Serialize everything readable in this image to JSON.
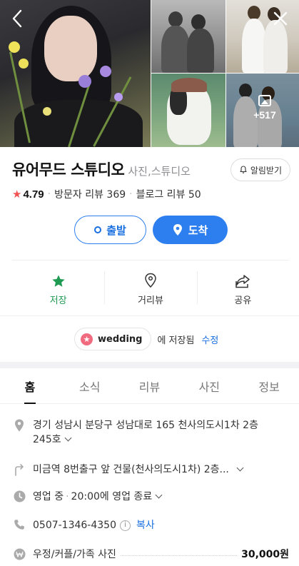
{
  "header": {
    "back_icon": "chevron-left-icon",
    "close_icon": "close-icon",
    "more_photos_count": "+517"
  },
  "place": {
    "name": "유어무드 스튜디오",
    "category": "사진,스튜디오",
    "alarm_label": "알림받기",
    "rating": "4.79",
    "visitor_reviews": "방문자 리뷰 369",
    "blog_reviews": "블로그 리뷰 50"
  },
  "route": {
    "departure_label": "출발",
    "arrival_label": "도착"
  },
  "actions": {
    "save_label": "저장",
    "streetview_label": "거리뷰",
    "share_label": "공유"
  },
  "saved": {
    "folder_name": "wedding",
    "saved_text": "에 저장됨",
    "edit_label": "수정"
  },
  "tabs": [
    {
      "label": "홈"
    },
    {
      "label": "소식"
    },
    {
      "label": "리뷰"
    },
    {
      "label": "사진"
    },
    {
      "label": "정보"
    }
  ],
  "info": {
    "address_line1": "경기 성남시 분당구 성남대로 165 천사의도시1차 2층",
    "address_line2": "245호",
    "directions": "미금역 8번출구 앞 건물(천사의도시1차) 2층...",
    "hours_status": "영업 중",
    "hours_detail": "20:00에 영업 종료",
    "phone": "0507-1346-4350",
    "copy_label": "복사",
    "menu_item": "우정/커플/가족 사진",
    "menu_price": "30,000원"
  },
  "colors": {
    "accent_blue": "#2d7ff0",
    "save_green": "#1f9a53",
    "star_red": "#f05050",
    "pill_pink": "#f06b80"
  }
}
